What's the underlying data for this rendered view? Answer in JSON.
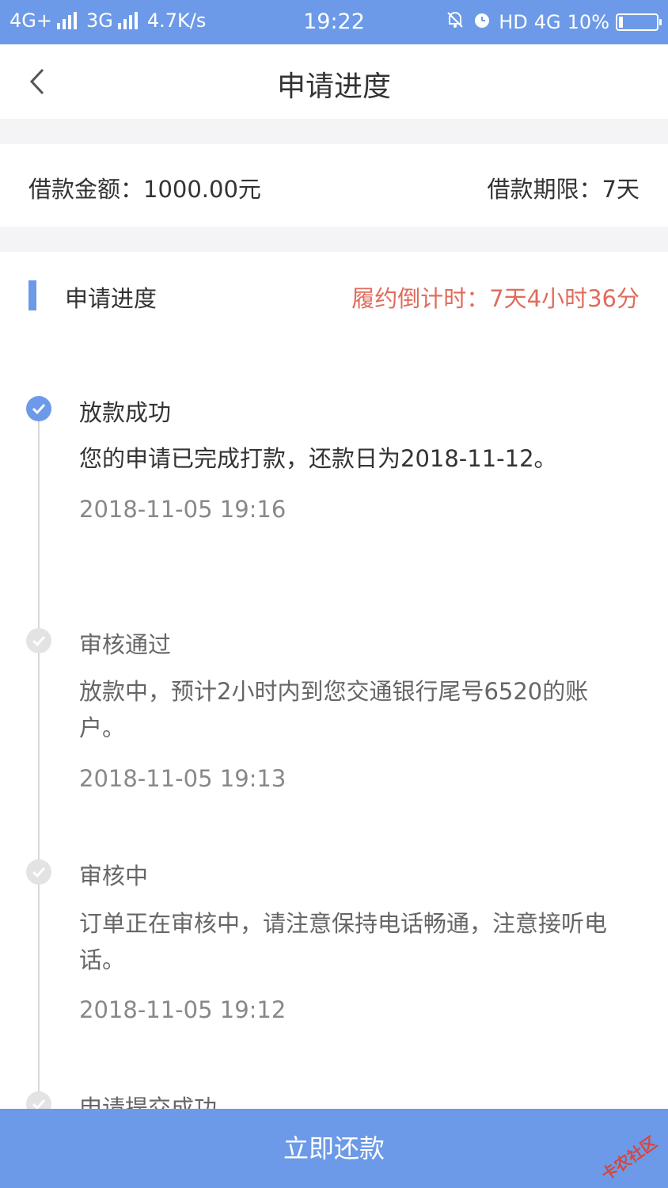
{
  "status_bar": {
    "network_left": "4G+",
    "network_mid": "3G",
    "speed": "4.7K/s",
    "time": "19:22",
    "hd": "HD",
    "network_right": "4G",
    "battery": "10%"
  },
  "nav": {
    "title": "申请进度",
    "back_icon": "chevron-left-icon"
  },
  "loan": {
    "amount": "借款金额：1000.00元",
    "term": "借款期限：7天"
  },
  "section": {
    "title": "申请进度",
    "countdown": "履约倒计时：7天4小时36分"
  },
  "timeline": [
    {
      "title": "放款成功",
      "desc": "您的申请已完成打款，还款日为2018-11-12。",
      "time": "2018-11-05 19:16",
      "state": "active"
    },
    {
      "title": "审核通过",
      "desc": "放款中，预计2小时内到您交通银行尾号6520的账户。",
      "time": "2018-11-05 19:13",
      "state": "inactive"
    },
    {
      "title": "审核中",
      "desc": "订单正在审核中，请注意保持电话畅通，注意接听电话。",
      "time": "2018-11-05 19:12",
      "state": "inactive"
    },
    {
      "title": "申请提交成功",
      "state": "inactive"
    }
  ],
  "repay_button": "立即还款",
  "watermark": "卡农社区",
  "colors": {
    "accent": "#6c9ae8",
    "countdown": "#e06c5c",
    "background_gap": "#f4f4f6"
  }
}
